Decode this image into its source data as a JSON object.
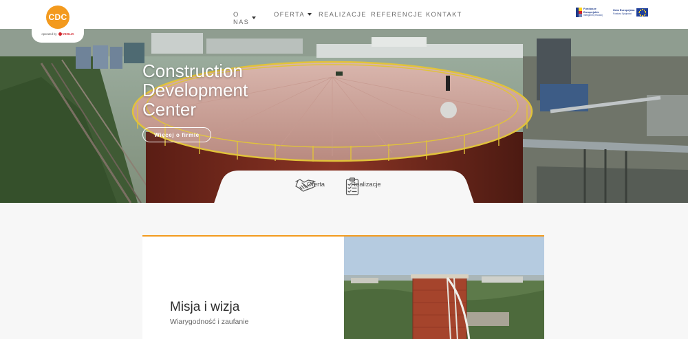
{
  "header": {
    "logo": {
      "text": "CDC",
      "sub_text": "operated by",
      "partner": "VEOLIA"
    },
    "nav": [
      {
        "label": "O NAS",
        "has_dropdown": true
      },
      {
        "label": "OFERTA",
        "has_dropdown": true
      },
      {
        "label": "REALIZACJE",
        "has_dropdown": false
      },
      {
        "label": "REFERENCJE",
        "has_dropdown": false
      },
      {
        "label": "KONTAKT",
        "has_dropdown": false
      }
    ],
    "eu": {
      "funds_line1": "Fundusze",
      "funds_line2": "Europejskie",
      "funds_line3": "Inteligentny Rozwój",
      "union_line1": "Unia Europejska",
      "union_line2": "Fundusz Spójności"
    }
  },
  "hero": {
    "title_lines": [
      "Construction",
      "Development",
      "Center"
    ],
    "button_label": "Więcej o firmie",
    "quick_links": [
      {
        "label": "Oferta",
        "icon": "handshake-icon"
      },
      {
        "label": "Realizacje",
        "icon": "checklist-icon"
      }
    ]
  },
  "mission": {
    "title": "Misja i wizja",
    "subtitle": "Wiarygodność i zaufanie"
  },
  "colors": {
    "accent": "#f39a1e",
    "veolia_red": "#d2232a",
    "eu_blue": "#1f3f9a",
    "nav_text": "#6a6a6a"
  }
}
